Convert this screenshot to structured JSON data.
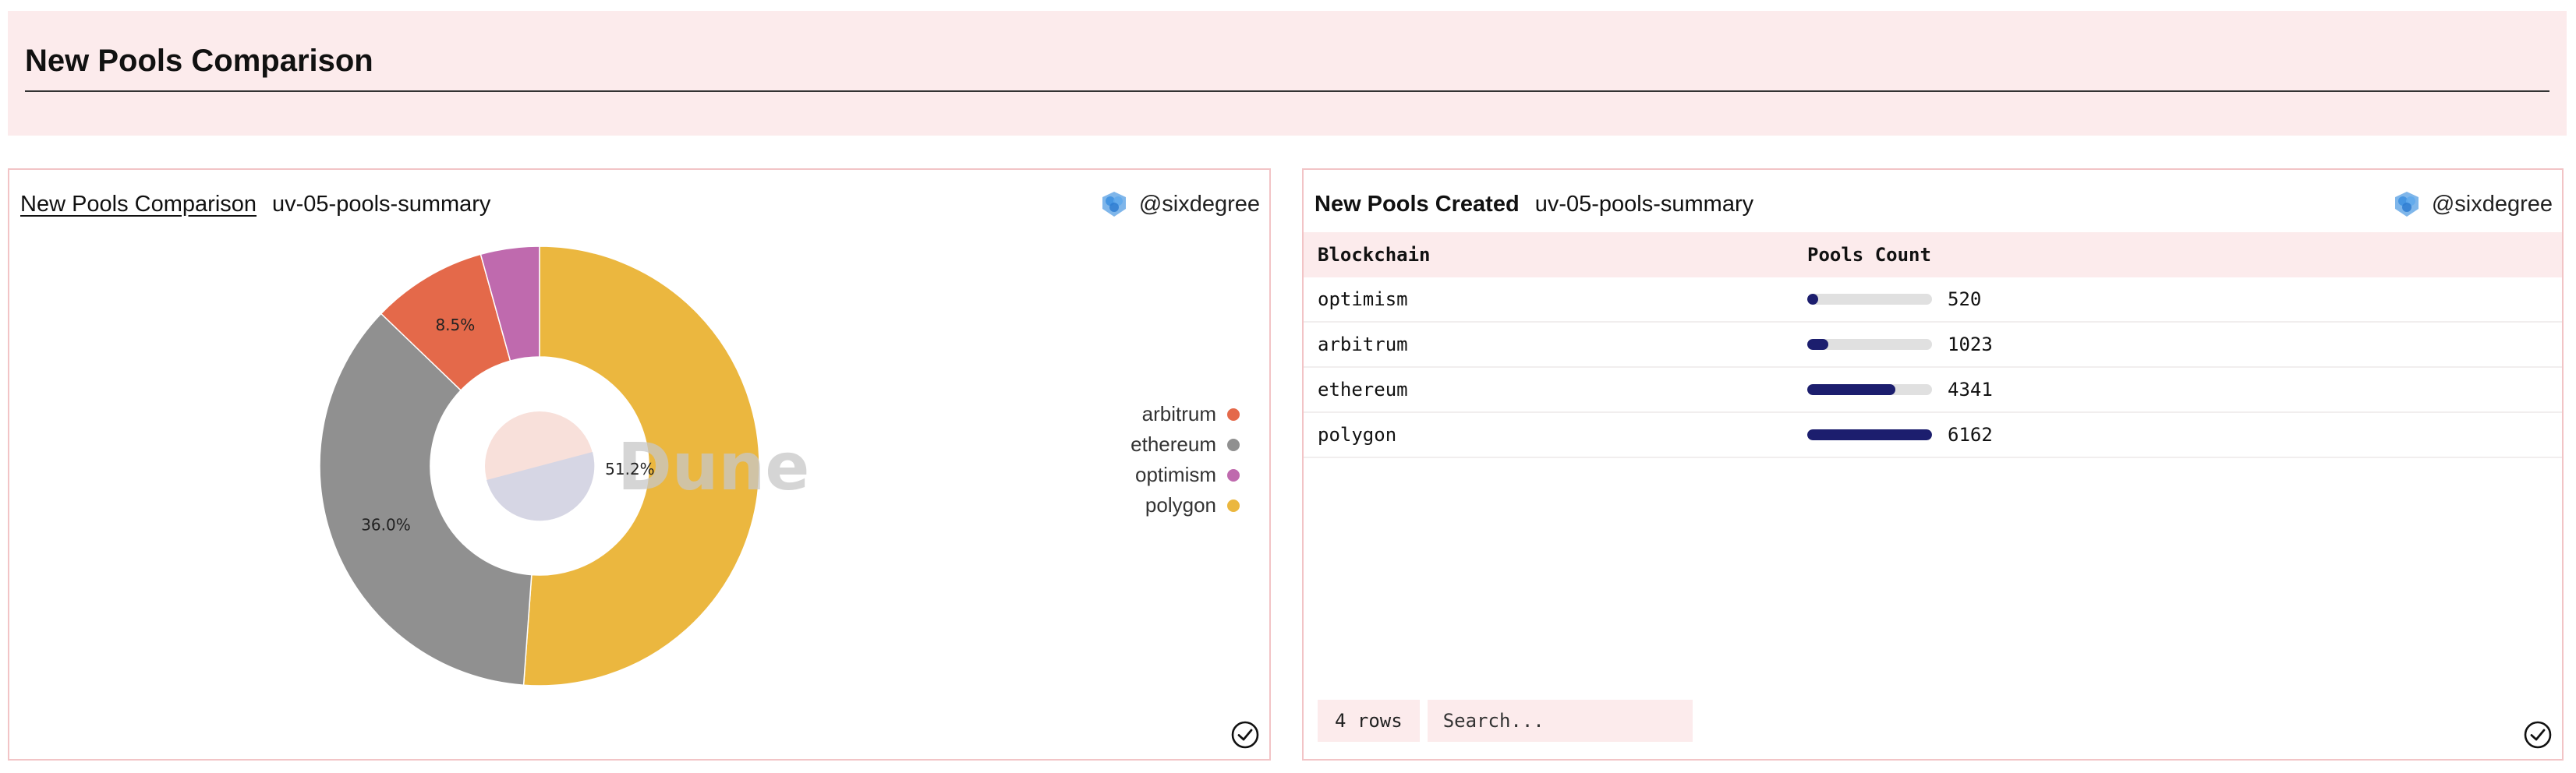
{
  "header": {
    "title": "New Pools Comparison"
  },
  "left_card": {
    "title": "New Pools Comparison",
    "subtitle": "uv-05-pools-summary",
    "author": "@sixdegree",
    "watermark": "Dune",
    "legend": [
      {
        "label": "arbitrum",
        "color": "#e4694a"
      },
      {
        "label": "ethereum",
        "color": "#909090"
      },
      {
        "label": "optimism",
        "color": "#bf6aae"
      },
      {
        "label": "polygon",
        "color": "#ebb73f"
      }
    ]
  },
  "right_card": {
    "title": "New Pools Created",
    "subtitle": "uv-05-pools-summary",
    "author": "@sixdegree",
    "columns": [
      "Blockchain",
      "Pools Count"
    ],
    "rows": [
      {
        "chain": "optimism",
        "count": "520"
      },
      {
        "chain": "arbitrum",
        "count": "1023"
      },
      {
        "chain": "ethereum",
        "count": "4341"
      },
      {
        "chain": "polygon",
        "count": "6162"
      }
    ],
    "rows_label": "4 rows",
    "search_placeholder": "Search..."
  },
  "chart_data": {
    "type": "pie",
    "style": "donut",
    "legend_position": "right",
    "slices": [
      {
        "name": "polygon",
        "value": 6162,
        "label": "51.2%",
        "color": "#ebb73f"
      },
      {
        "name": "ethereum",
        "value": 4341,
        "label": "36.0%",
        "color": "#909090"
      },
      {
        "name": "arbitrum",
        "value": 1023,
        "label": "8.5%",
        "color": "#e4694a"
      },
      {
        "name": "optimism",
        "value": 520,
        "label": "",
        "color": "#bf6aae"
      }
    ]
  },
  "colors": {
    "panel_bg": "#fcebec",
    "card_border": "#f2c4c6",
    "bar_fill": "#1c1e6e",
    "bar_track": "#e0e0e0"
  }
}
